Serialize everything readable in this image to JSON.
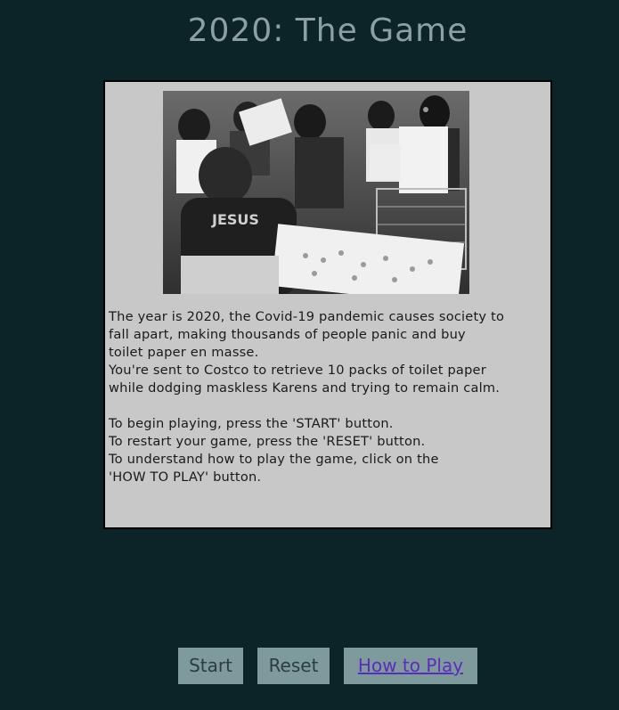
{
  "header": {
    "title": "2020: The Game"
  },
  "intro": {
    "image": {
      "icon": "shopping-crowd-photo"
    },
    "paragraphs": [
      "The year is 2020, the Covid-19 pandemic causes society to",
      "fall apart, making thousands of people panic and buy",
      "toilet paper en masse.",
      "You're sent to Costco to retrieve 10 packs of toilet paper",
      "while dodging maskless Karens and trying to remain calm.",
      "To begin playing, press the 'START' button.",
      "To restart your game, press the 'RESET' button.",
      "To understand how to play the game, click on the",
      "'HOW TO PLAY' button."
    ]
  },
  "controls": {
    "start_label": "Start",
    "reset_label": "Reset",
    "howto_label": "How to Play"
  },
  "colors": {
    "background": "#0c2427",
    "panel": "#c8c8c8",
    "button": "#7f9a9c",
    "title": "#8aa0a3",
    "link": "#5a2dbd"
  }
}
